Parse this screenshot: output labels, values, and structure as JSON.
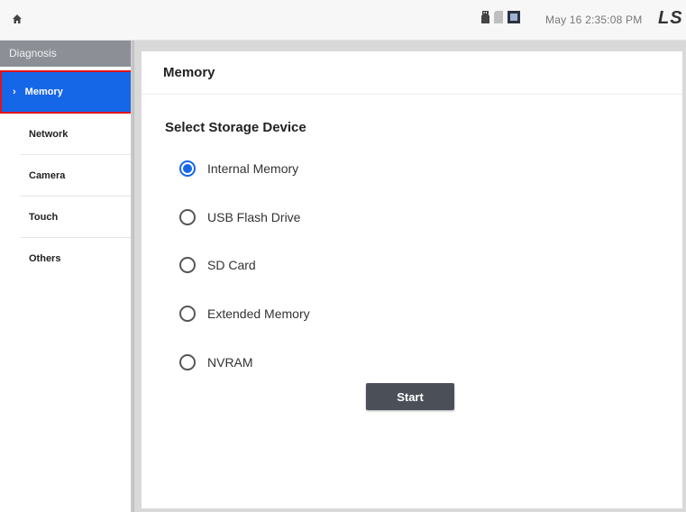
{
  "topbar": {
    "clock": "May 16 2:35:08 PM",
    "logo": "LS"
  },
  "sidebar": {
    "header": "Diagnosis",
    "items": [
      {
        "label": "Memory",
        "active": true
      },
      {
        "label": "Network",
        "active": false
      },
      {
        "label": "Camera",
        "active": false
      },
      {
        "label": "Touch",
        "active": false
      },
      {
        "label": "Others",
        "active": false
      }
    ]
  },
  "panel": {
    "title": "Memory",
    "section_title": "Select Storage Device",
    "options": [
      {
        "label": "Internal Memory",
        "selected": true
      },
      {
        "label": "USB Flash Drive",
        "selected": false
      },
      {
        "label": "SD Card",
        "selected": false
      },
      {
        "label": "Extended Memory",
        "selected": false
      },
      {
        "label": "NVRAM",
        "selected": false
      }
    ],
    "start_label": "Start"
  },
  "colors": {
    "accent": "#1666e8",
    "highlight_border": "#e3131c",
    "sidebar_header": "#8c9096",
    "button": "#4b4f58"
  }
}
